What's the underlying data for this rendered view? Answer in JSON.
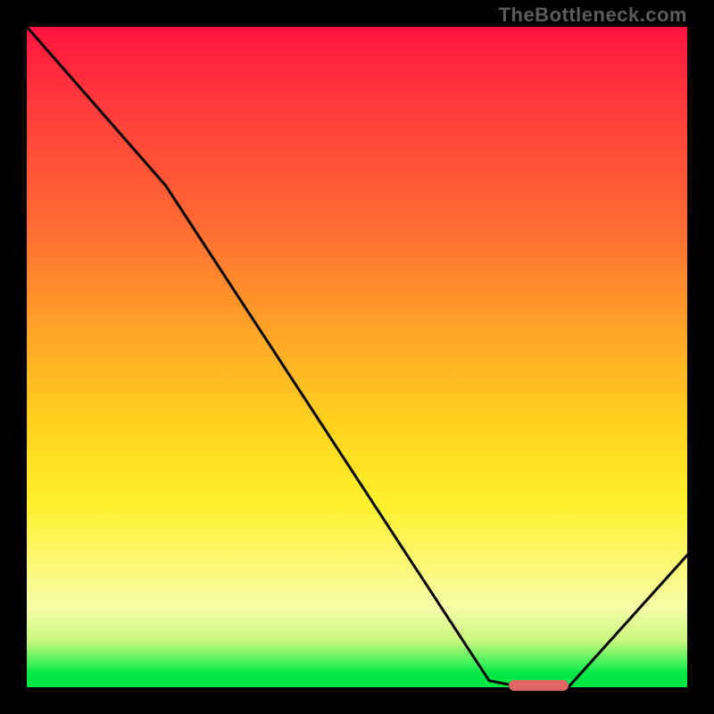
{
  "watermark": "TheBottleneck.com",
  "chart_data": {
    "type": "line",
    "title": "",
    "xlabel": "",
    "ylabel": "",
    "xlim": [
      0,
      100
    ],
    "ylim": [
      0,
      100
    ],
    "grid": false,
    "series": [
      {
        "name": "bottleneck-curve",
        "x": [
          0,
          21,
          70,
          75,
          82,
          100
        ],
        "values": [
          100,
          76,
          1,
          0,
          0,
          20
        ]
      }
    ],
    "annotations": [
      {
        "name": "optimal-range-marker",
        "x0": 73,
        "x1": 82,
        "y": 0,
        "color": "#e06666"
      }
    ],
    "background_gradient": {
      "direction": "vertical",
      "stops": [
        {
          "pos": 0.0,
          "color": "#ff143f"
        },
        {
          "pos": 0.3,
          "color": "#ff6a33"
        },
        {
          "pos": 0.6,
          "color": "#ffd21f"
        },
        {
          "pos": 0.88,
          "color": "#f5fca8"
        },
        {
          "pos": 0.98,
          "color": "#00e747"
        },
        {
          "pos": 1.0,
          "color": "#00e747"
        }
      ]
    }
  }
}
